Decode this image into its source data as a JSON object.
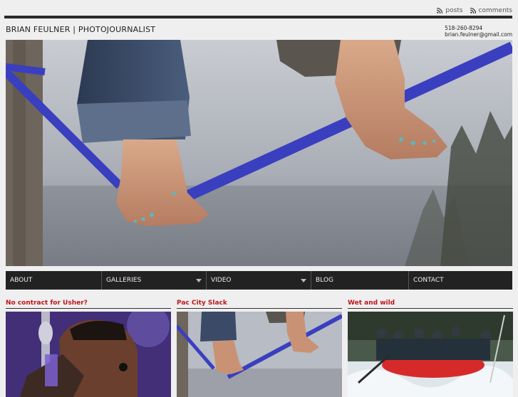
{
  "header": {
    "feeds": [
      {
        "label": "posts",
        "icon": "rss-icon"
      },
      {
        "label": "comments",
        "icon": "rss-icon"
      }
    ],
    "site_title": "BRIAN FEULNER | PHOTOJOURNALIST",
    "phone": "518-260-8294",
    "email": "brian.feulner@gmail.com"
  },
  "nav": {
    "items": [
      {
        "label": "ABOUT",
        "dropdown": false
      },
      {
        "label": "GALLERIES",
        "dropdown": true
      },
      {
        "label": "VIDEO",
        "dropdown": true
      },
      {
        "label": "BLOG",
        "dropdown": false
      },
      {
        "label": "CONTACT",
        "dropdown": false
      }
    ]
  },
  "posts": [
    {
      "title": "No contract for Usher?"
    },
    {
      "title": "Pac City Slack"
    },
    {
      "title": "Wet and wild"
    }
  ],
  "colors": {
    "accent": "#c0141b",
    "nav_bg": "#222222",
    "slackline": "#3a3fbf"
  }
}
